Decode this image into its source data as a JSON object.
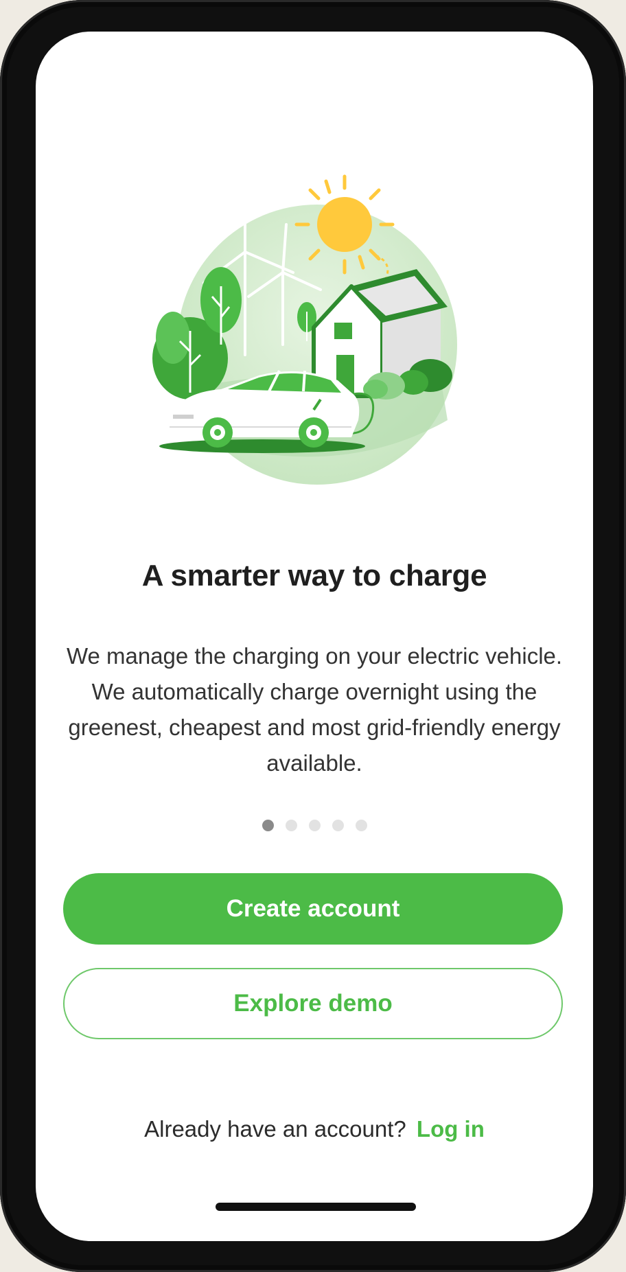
{
  "onboarding": {
    "title": "A smarter way to charge",
    "description": "We manage the charging on your electric vehicle. We automatically charge overnight using the greenest, cheapest and most grid-friendly energy available.",
    "pagination": {
      "total": 5,
      "current": 1
    },
    "illustration_icon": "ev-home-charging-illustration"
  },
  "actions": {
    "create_account_label": "Create account",
    "explore_demo_label": "Explore demo"
  },
  "login": {
    "prompt": "Already have an account?",
    "link_label": "Log in"
  },
  "colors": {
    "accent": "#4cbb47",
    "accent_light": "#d5edd0",
    "sun": "#ffc93c"
  }
}
